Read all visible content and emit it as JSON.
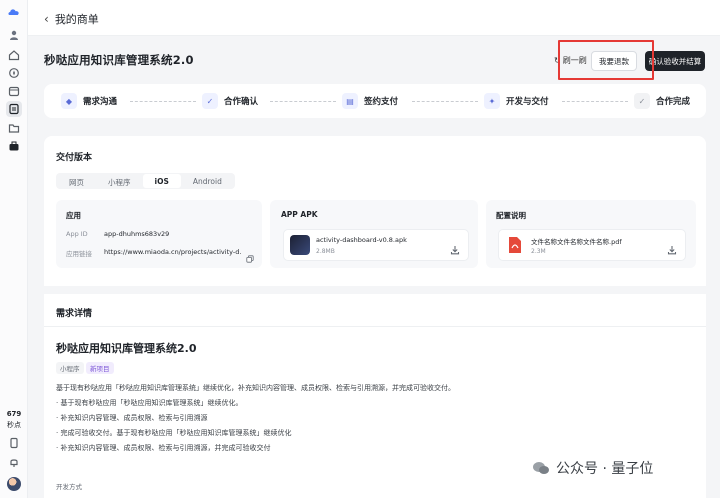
{
  "header": {
    "back_label": "我的商单"
  },
  "page": {
    "title": "秒哒应用知识库管理系统2.0"
  },
  "actions": {
    "refresh_label": "刷一刷",
    "refund_label": "我要退款",
    "accept_label": "确认验收并结算"
  },
  "steps": [
    {
      "label": "需求沟通",
      "icon": "chat-icon"
    },
    {
      "label": "合作确认",
      "icon": "check-doc-icon"
    },
    {
      "label": "签约支付",
      "icon": "contract-icon"
    },
    {
      "label": "开发与交付",
      "icon": "dev-icon"
    },
    {
      "label": "合作完成",
      "icon": "complete-icon"
    }
  ],
  "delivery": {
    "title": "交付版本",
    "tabs": [
      "网页",
      "小程序",
      "iOS",
      "Android"
    ],
    "active_tab": "iOS",
    "app_info": {
      "title": "应用",
      "id_label": "App ID",
      "id_value": "app-dhuhms683v29",
      "link_label": "应用链接",
      "link_value": "https://www.miaoda.cn/projects/activity-d..."
    },
    "apk": {
      "title": "APP APK",
      "file_name": "activity-dashboard-v0.8.apk",
      "file_size": "2.8MB"
    },
    "config": {
      "title": "配置说明",
      "file_name": "文件名称文件名称文件名称.pdf",
      "file_size": "2.3M"
    }
  },
  "requirements": {
    "title": "需求详情",
    "app_name": "秒哒应用知识库管理系统2.0",
    "tags": [
      "小程序",
      "新项目"
    ],
    "lines": [
      "基于现有秒哒应用「秒哒应用知识库管理系统」继续优化，补充知识内容管理、成员权限、检索与引用溯源，并完成可验收交付。",
      "· 基于现有秒哒应用「秒哒应用知识库管理系统」继续优化。",
      "· 补充知识内容管理、成员权限、检索与引用溯源",
      "· 完成可验收交付。基于现有秒哒应用「秒哒应用知识库管理系统」继续优化",
      "· 补充知识内容管理、成员权限、检索与引用溯源，并完成可验收交付"
    ],
    "dev_mode_label": "开发方式"
  },
  "sidebar": {
    "points_value": "679",
    "points_label": "秒点"
  },
  "watermark": {
    "text": "公众号 · 量子位"
  },
  "colors": {
    "highlight": "#e53935",
    "primary_dark": "#1f2329",
    "accent": "#5a6bd6"
  }
}
